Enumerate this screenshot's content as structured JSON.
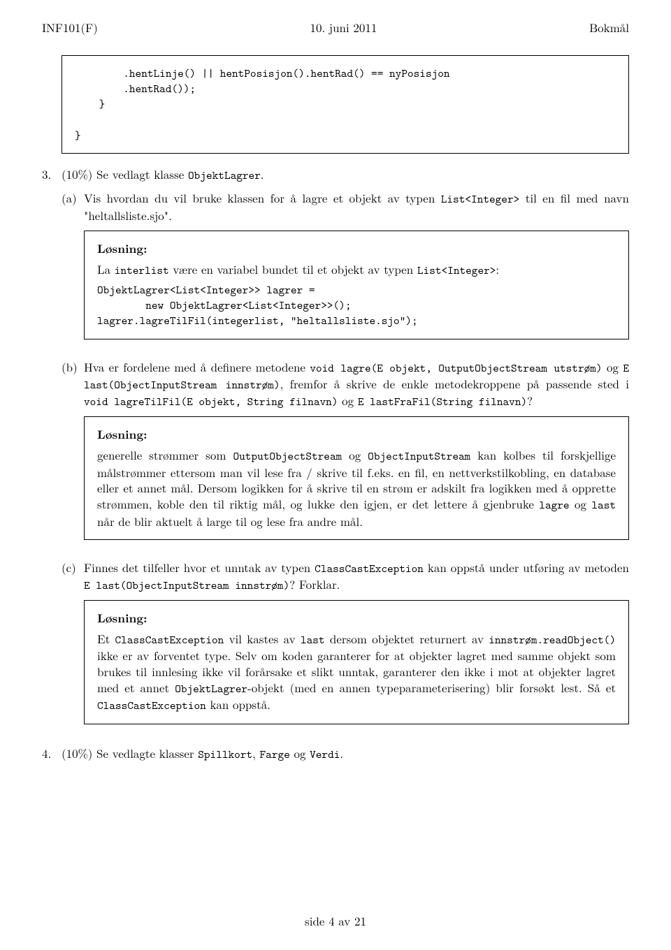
{
  "header": {
    "left": "INF101(F)",
    "center": "10. juni 2011",
    "right": "Bokmål"
  },
  "codebox1": {
    "line1": "        .hentLinje() || hentPosisjon().hentRad() == nyPosisjon",
    "line2": "        .hentRad());",
    "line3": "    }",
    "line4": "",
    "line5": "}"
  },
  "q3": {
    "num": "3.",
    "intro_pre": "(10%) Se vedlagt klasse ",
    "intro_tt": "ObjektLagrer",
    "intro_post": ".",
    "a": {
      "lbl": "(a)",
      "text_pre": "Vis hvordan du vil bruke klassen for å lagre et objekt av typen ",
      "text_tt": "List<Integer>",
      "text_post": " til en fil med navn \"heltallsliste.sjo\"."
    },
    "sol_a": {
      "title": "Løsning:",
      "para_pre": "La ",
      "para_tt1": "interlist",
      "para_mid": " være en variabel bundet til et objekt av typen ",
      "para_tt2": "List<Integer>",
      "para_post": ":",
      "code1": "ObjektLagrer<List<Integer>> lagrer =",
      "code2": "        new ObjektLagrer<List<Integer>>();",
      "code3": "lagrer.lagreTilFil(integerlist, \"heltallsliste.sjo\");"
    },
    "b": {
      "lbl": "(b)",
      "s1": "Hva er fordelene med å definere metodene ",
      "t1": "void lagre(E objekt, OutputObjectStream utstrøm)",
      "s2": " og ",
      "t2": "E last(ObjectInputStream innstrøm)",
      "s3": ", fremfor å skrive de enkle metodekroppene på passende sted i ",
      "t3": "void lagreTilFil(E objekt, String filnavn)",
      "s4": " og ",
      "t4": "E lastFraFil(String filnavn)",
      "s5": "?"
    },
    "sol_b": {
      "title": "Løsning:",
      "p1a": "generelle strømmer som ",
      "p1t1": "OutputObjectStream",
      "p1b": " og ",
      "p1t2": "ObjectInputStream",
      "p1c": " kan kolbes til forskjellige målstrømmer ettersom man vil lese fra / skrive til f.eks. en fil, en nettverkstilkobling, en database eller et annet mål. Dersom logikken for å skrive til en strøm er adskilt fra logikken med å opprette strømmen, koble den til riktig mål, og lukke den igjen, er det lettere å gjenbruke ",
      "p1t3": "lagre",
      "p1d": " og ",
      "p1t4": "last",
      "p1e": " når de blir aktuelt å large til og lese fra andre mål."
    },
    "c": {
      "lbl": "(c)",
      "s1": "Finnes det tilfeller hvor et unntak av typen ",
      "t1": "ClassCastException",
      "s2": " kan oppstå under utføring av metoden ",
      "t2": "E last(ObjectInputStream innstrøm)",
      "s3": "? Forklar."
    },
    "sol_c": {
      "title": "Løsning:",
      "p1a": "Et ",
      "t1": "ClassCastException",
      "p1b": " vil kastes av ",
      "t2": "last",
      "p1c": " dersom objektet returnert av ",
      "t3": "innstrøm.readObject()",
      "p1d": " ikke er av forventet type.  Selv om koden garanterer for at objekter lagret med samme objekt som brukes til innlesing ikke vil forårsake et slikt unntak, garanterer den ikke i mot at objekter lagret med et annet ",
      "t4": "ObjektLagrer",
      "p1e": "-objekt (med en annen typeparameterisering) blir forsøkt lest. Så et ",
      "t5": "ClassCastException",
      "p1f": " kan oppstå."
    }
  },
  "q4": {
    "num": "4.",
    "s1": "(10%) Se vedlagte klasser ",
    "t1": "Spillkort",
    "s2": ", ",
    "t2": "Farge",
    "s3": " og ",
    "t3": "Verdi",
    "s4": "."
  },
  "footer": "side 4 av 21"
}
